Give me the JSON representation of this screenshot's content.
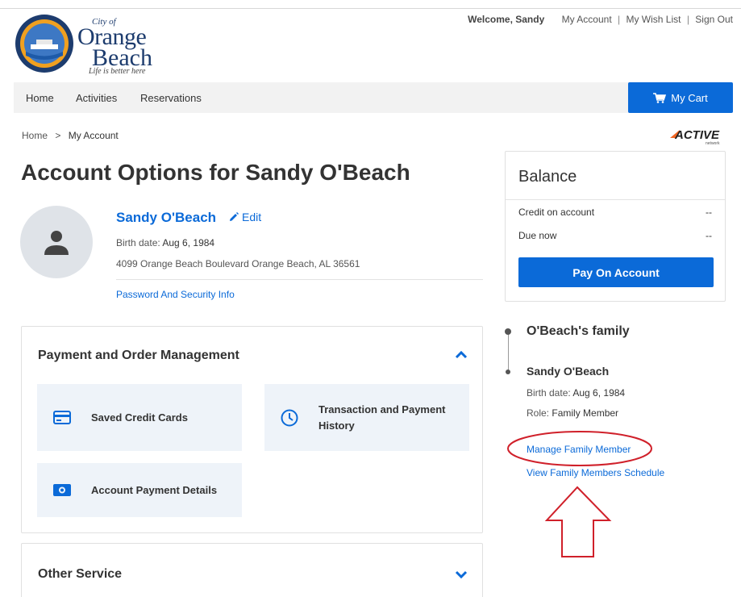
{
  "logo": {
    "city_of": "City of",
    "line1": "Orange",
    "line2": "Beach",
    "tagline": "Life is better here",
    "seal_text": "ORANGE BEACH ALABAMA"
  },
  "header": {
    "welcome": "Welcome, Sandy",
    "links": [
      "My Account",
      "My Wish List",
      "Sign Out"
    ],
    "separator": "|"
  },
  "nav": {
    "items": [
      "Home",
      "Activities",
      "Reservations"
    ],
    "cart_label": "My Cart",
    "cart_icon": "cart-icon"
  },
  "breadcrumb": {
    "home": "Home",
    "separator": ">",
    "current": "My Account"
  },
  "brand": {
    "active_wordmark": "ACTIVE",
    "active_sub": "network"
  },
  "page": {
    "title": "Account Options for Sandy O'Beach"
  },
  "profile": {
    "name": "Sandy O'Beach",
    "edit_label": "Edit",
    "birth_label": "Birth date:",
    "birth_value": "Aug 6, 1984",
    "address": "4099 Orange Beach Boulevard Orange Beach, AL 36561",
    "security_link": "Password And Security Info"
  },
  "payment_section": {
    "title": "Payment and Order Management",
    "expanded": true,
    "tiles": [
      {
        "label": "Saved Credit Cards",
        "icon": "credit-card-icon"
      },
      {
        "label": "Transaction and Payment",
        "label2": "History",
        "icon": "clock-icon"
      },
      {
        "label": "Account Payment Details",
        "icon": "money-icon"
      }
    ]
  },
  "other_section": {
    "title": "Other Service",
    "expanded": false
  },
  "balance": {
    "title": "Balance",
    "rows": [
      {
        "label": "Credit on account",
        "value": "--"
      },
      {
        "label": "Due now",
        "value": "--"
      }
    ],
    "pay_button": "Pay On Account"
  },
  "family": {
    "title": "O'Beach's family",
    "member_name": "Sandy O'Beach",
    "birth_label": "Birth date:",
    "birth_value": "Aug 6, 1984",
    "role_label": "Role:",
    "role_value": "Family Member",
    "manage_link": "Manage Family Member",
    "schedule_link": "View Family Members Schedule"
  },
  "colors": {
    "accent": "#0b6ad8",
    "annotation": "#d0202a",
    "tile_bg": "#eef3f9"
  }
}
